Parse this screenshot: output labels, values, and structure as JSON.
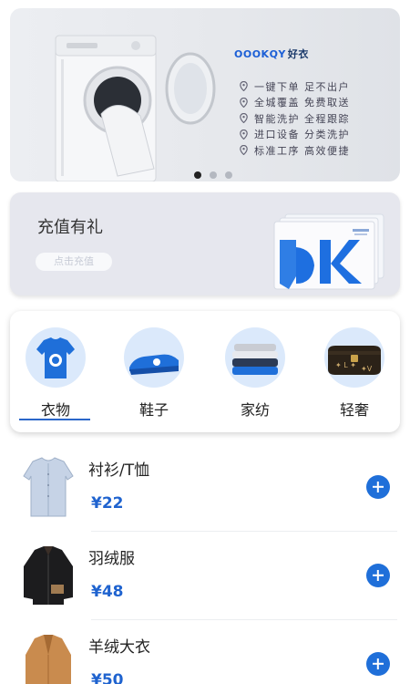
{
  "banner": {
    "brand_logo": "OOOKQY",
    "brand_cn": "好衣",
    "features": [
      "一键下单  足不出户",
      "全城覆盖  免费取送",
      "智能洗护  全程跟踪",
      "进口设备  分类洗护",
      "标准工序  高效便捷"
    ],
    "carousel_count": 3,
    "carousel_active": 1
  },
  "recharge": {
    "title": "充值有礼",
    "button": "点击充值"
  },
  "categories": {
    "items": [
      {
        "label": "衣物",
        "icon": "shirt-icon"
      },
      {
        "label": "鞋子",
        "icon": "shoe-icon"
      },
      {
        "label": "家纺",
        "icon": "bedding-icon"
      },
      {
        "label": "轻奢",
        "icon": "luxury-bag-icon"
      }
    ],
    "selected": 0
  },
  "products": [
    {
      "name": "衬衫/T恤",
      "price": "¥22",
      "icon": "shirt-thumbnail"
    },
    {
      "name": "羽绒服",
      "price": "¥48",
      "icon": "down-jacket-thumbnail"
    },
    {
      "name": "羊绒大衣",
      "price": "¥50",
      "icon": "wool-coat-thumbnail"
    }
  ],
  "colors": {
    "accent": "#1f6fd9",
    "price": "#1f63cf"
  }
}
